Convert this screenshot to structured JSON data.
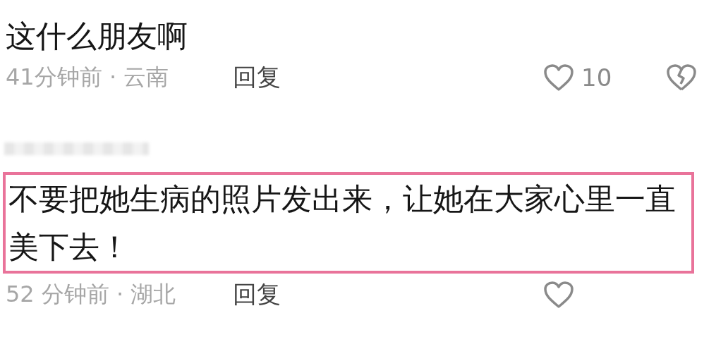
{
  "comments": [
    {
      "author_blurred": false,
      "text": "这什么朋友啊",
      "highlighted": false,
      "time": "41分钟前 · 云南",
      "reply": "回复",
      "liked": false,
      "like_count": "10",
      "dislike": true
    },
    {
      "author_blurred": true,
      "text": "不要把她生病的照片发出来，让她在大家心里一直美下去！",
      "highlighted": true,
      "time": "52 分钟前 · 湖北",
      "reply": "回复",
      "liked": false,
      "dislike": false
    }
  ]
}
